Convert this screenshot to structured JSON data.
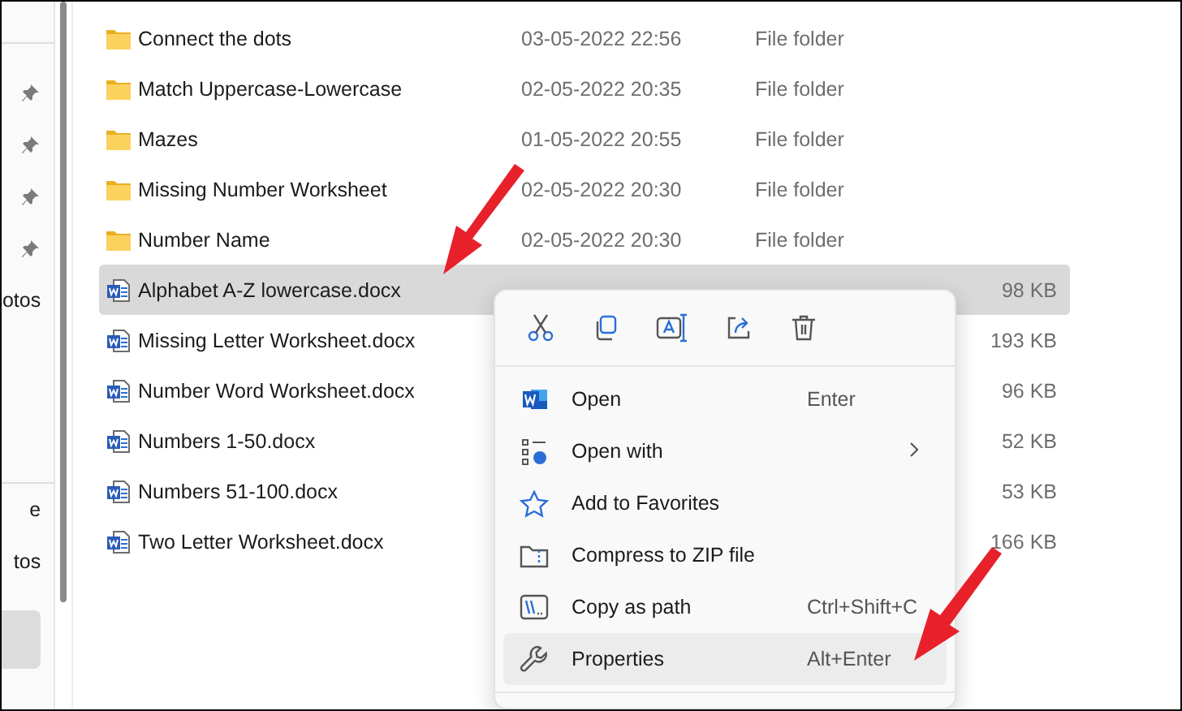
{
  "sidebar": {
    "items": [
      {
        "label": "otos",
        "selected": false
      },
      {
        "label": "e",
        "selected": false
      },
      {
        "label": "tos",
        "selected": false
      },
      {
        "selected": true
      }
    ],
    "pins": [
      {
        "pinned": true
      },
      {
        "pinned": true
      },
      {
        "pinned": true
      },
      {
        "pinned": true
      }
    ]
  },
  "files": [
    {
      "kind": "folder",
      "name": "Connect the dots",
      "date": "03-05-2022 22:56",
      "type": "File folder",
      "selected": false
    },
    {
      "kind": "folder",
      "name": "Match Uppercase-Lowercase",
      "date": "02-05-2022 20:35",
      "type": "File folder",
      "selected": false
    },
    {
      "kind": "folder",
      "name": "Mazes",
      "date": "01-05-2022 20:55",
      "type": "File folder",
      "selected": false
    },
    {
      "kind": "folder",
      "name": "Missing Number Worksheet",
      "date": "02-05-2022 20:30",
      "type": "File folder",
      "selected": false
    },
    {
      "kind": "folder",
      "name": "Number Name",
      "date": "02-05-2022 20:30",
      "type": "File folder",
      "selected": false
    },
    {
      "kind": "word",
      "name": "Alphabet A-Z lowercase.docx",
      "size": "98 KB",
      "selected": true
    },
    {
      "kind": "word",
      "name": "Missing Letter Worksheet.docx",
      "size": "193 KB",
      "selected": false
    },
    {
      "kind": "word",
      "name": "Number Word Worksheet.docx",
      "size": "96 KB",
      "selected": false
    },
    {
      "kind": "word",
      "name": "Numbers 1-50.docx",
      "size": "52 KB",
      "selected": false
    },
    {
      "kind": "word",
      "name": "Numbers 51-100.docx",
      "size": "53 KB",
      "selected": false
    },
    {
      "kind": "word",
      "name": "Two Letter Worksheet.docx",
      "size": "166 KB",
      "selected": false
    }
  ],
  "context_menu": {
    "toolbar": [
      {
        "kind": "cut"
      },
      {
        "kind": "copy"
      },
      {
        "kind": "rename"
      },
      {
        "kind": "share"
      },
      {
        "kind": "delete"
      }
    ],
    "items": [
      {
        "kind": "word",
        "label": "Open",
        "shortcut": "Enter",
        "submenu": false,
        "highlighted": false
      },
      {
        "kind": "open-with",
        "label": "Open with",
        "submenu": true,
        "highlighted": false
      },
      {
        "kind": "star",
        "label": "Add to Favorites",
        "submenu": false,
        "highlighted": false
      },
      {
        "kind": "zip",
        "label": "Compress to ZIP file",
        "submenu": false,
        "highlighted": false
      },
      {
        "kind": "path",
        "label": "Copy as path",
        "shortcut": "Ctrl+Shift+C",
        "submenu": false,
        "highlighted": false
      },
      {
        "kind": "wrench",
        "label": "Properties",
        "shortcut": "Alt+Enter",
        "submenu": false,
        "highlighted": true
      }
    ]
  }
}
